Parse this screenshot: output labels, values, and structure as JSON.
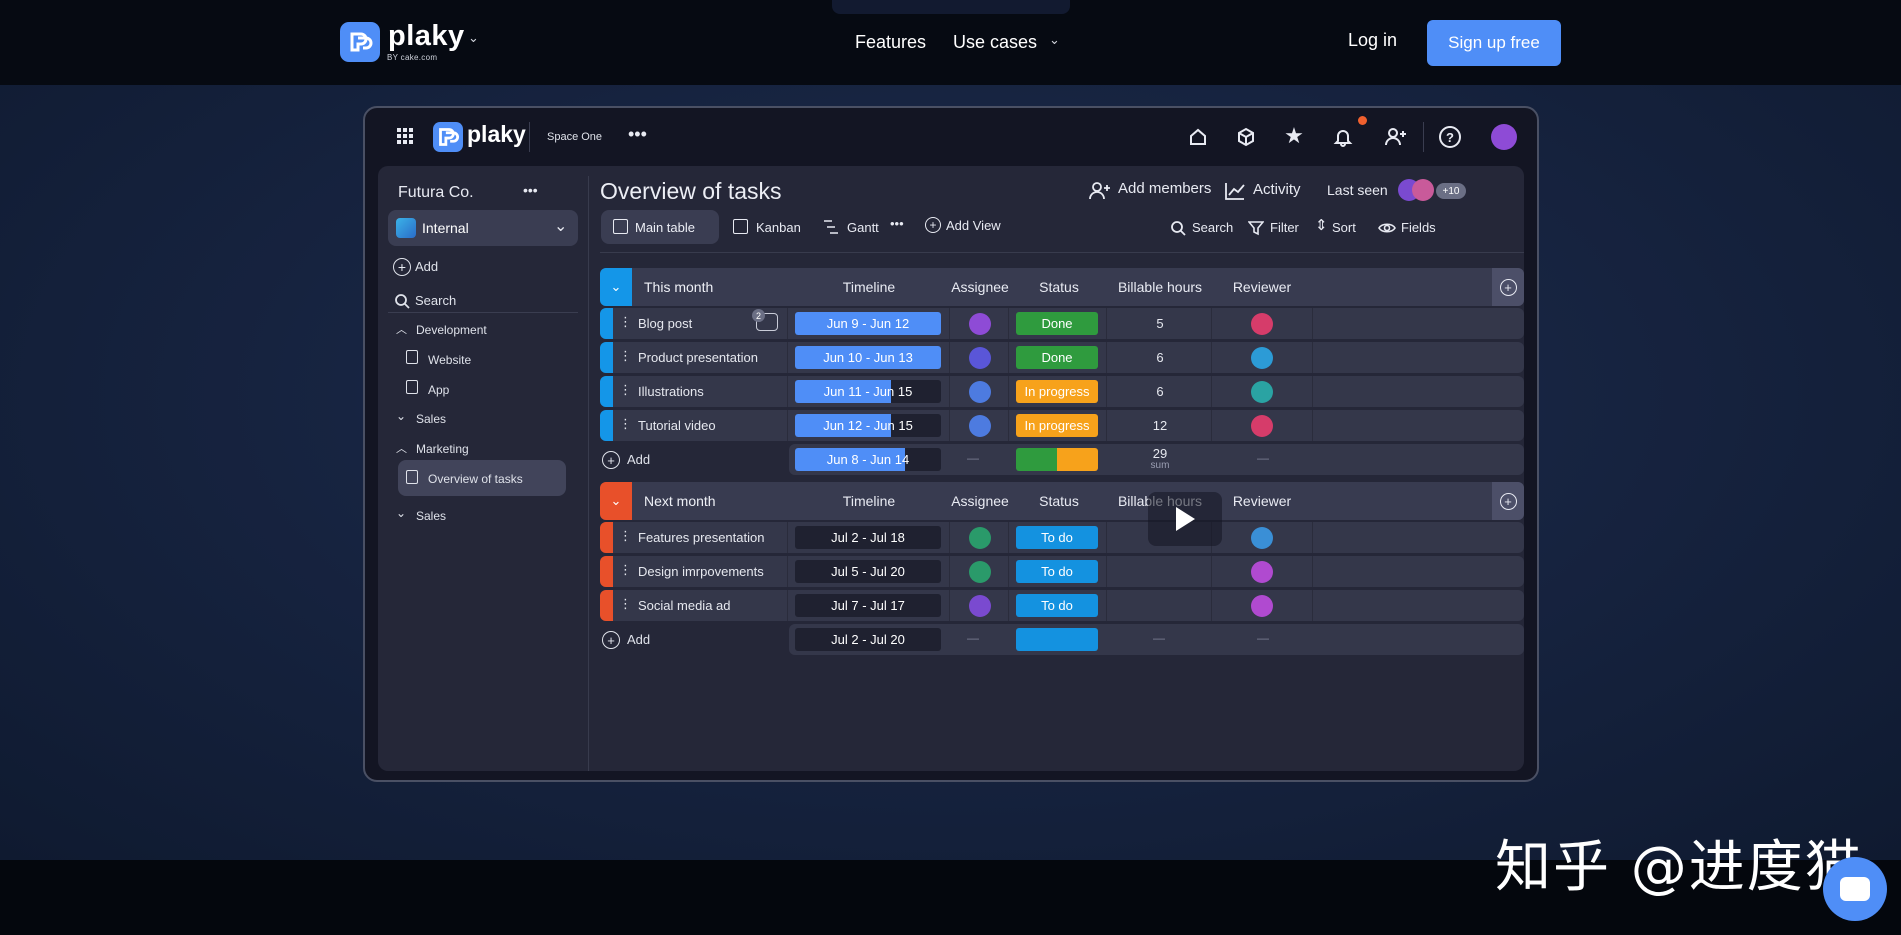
{
  "site_nav": {
    "brand": "plaky",
    "brand_sub": "BY cake.com",
    "links": [
      "Features",
      "Use cases"
    ],
    "login": "Log in",
    "signup": "Sign up free"
  },
  "app": {
    "brand": "plaky",
    "space": "Space One",
    "workspace": "Futura Co.",
    "workspace_dropdown": "Internal",
    "sidebar": {
      "add": "Add",
      "search": "Search",
      "tree": [
        {
          "label": "Development",
          "kind": "folder",
          "expanded": true
        },
        {
          "label": "Website",
          "kind": "board"
        },
        {
          "label": "App",
          "kind": "board"
        },
        {
          "label": "Sales",
          "kind": "folder",
          "expanded": false
        },
        {
          "label": "Marketing",
          "kind": "folder",
          "expanded": true
        },
        {
          "label": "Overview of tasks",
          "kind": "board",
          "active": true
        },
        {
          "label": "Sales",
          "kind": "folder",
          "expanded": false
        }
      ]
    },
    "board": {
      "title": "Overview of tasks",
      "add_members": "Add members",
      "activity": "Activity",
      "last_seen": "Last seen",
      "last_seen_count": "+10",
      "views": [
        "Main table",
        "Kanban",
        "Gantt"
      ],
      "add_view": "Add View",
      "tools": [
        "Search",
        "Filter",
        "Sort",
        "Fields"
      ]
    },
    "columns": [
      "Timeline",
      "Assignee",
      "Status",
      "Billable hours",
      "Reviewer"
    ],
    "groups": [
      {
        "name": "This month",
        "color": "#1496e8",
        "rows": [
          {
            "task": "Blog post",
            "comments": "2",
            "timeline": "Jun 9 - Jun 12",
            "progress": 1.0,
            "status": "Done",
            "hours": "5",
            "assignee_color": "#8e4bd6",
            "reviewer_color": "#d63c6a"
          },
          {
            "task": "Product presentation",
            "comments": "",
            "timeline": "Jun 10 - Jun 13",
            "progress": 1.0,
            "status": "Done",
            "hours": "6",
            "assignee_color": "#5a56d8",
            "reviewer_color": "#2c9bd6"
          },
          {
            "task": "Illustrations",
            "comments": "",
            "timeline": "Jun 11 - Jun 15",
            "progress": 0.66,
            "status": "In progress",
            "hours": "6",
            "assignee_color": "#4d7be0",
            "reviewer_color": "#2aa3a3"
          },
          {
            "task": "Tutorial video",
            "comments": "",
            "timeline": "Jun 12 - Jun 15",
            "progress": 0.66,
            "status": "In progress",
            "hours": "12",
            "assignee_color": "#4d7be0",
            "reviewer_color": "#d63c6a"
          }
        ],
        "summary": {
          "add": "Add",
          "timeline": "Jun 8 - Jun 14",
          "progress": 0.75,
          "hours": "29",
          "hours_label": "sum",
          "empty": "—"
        }
      },
      {
        "name": "Next month",
        "color": "#e8502a",
        "rows": [
          {
            "task": "Features presentation",
            "comments": "",
            "timeline": "Jul 2 - Jul 18",
            "progress": 0,
            "status": "To do",
            "hours": "",
            "assignee_color": "#2a9a6a",
            "reviewer_color": "#3a8fd6"
          },
          {
            "task": "Design imrpovements",
            "comments": "",
            "timeline": "Jul 5  - Jul 20",
            "progress": 0,
            "status": "To do",
            "hours": "",
            "assignee_color": "#2a9a6a",
            "reviewer_color": "#b04ad0"
          },
          {
            "task": "Social media ad",
            "comments": "",
            "timeline": "Jul 7 - Jul 17",
            "progress": 0,
            "status": "To do",
            "hours": "",
            "assignee_color": "#7a4ad0",
            "reviewer_color": "#b04ad0"
          }
        ],
        "summary": {
          "add": "Add",
          "timeline": "Jul 2 - Jul 20",
          "progress": 0,
          "hours": "",
          "hours_label": "",
          "empty": "—"
        }
      }
    ],
    "status_colors": {
      "Done": "#2f9b3e",
      "In progress": "#f7a21b",
      "To do": "#1492e0"
    },
    "timeline_color": "#4f8ef7"
  },
  "watermark": "知乎 @进度猫"
}
